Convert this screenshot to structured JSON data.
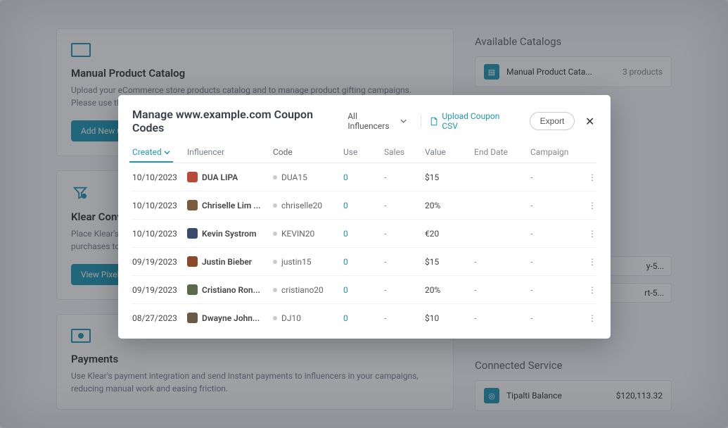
{
  "bg": {
    "catalog": {
      "title": "Manual Product Catalog",
      "desc": "Upload your eCommerce store products catalog and to manage product gifting campaigns. Please use the template below.",
      "btn": "Add New C"
    },
    "conv": {
      "title": "Klear Conv",
      "desc1": "Place Klear's c",
      "desc2": "purchases to a",
      "btn": "View Pixel"
    },
    "payments": {
      "title": "Payments",
      "desc": "Use Klear's payment integration and send instant payments to influencers in your campaigns, reducing manual work and easing friction."
    },
    "side": {
      "catalogs_h": "Available Catalogs",
      "cat_name": "Manual Product Cata...",
      "cat_count": "3 products",
      "conn_h": "Connected Service",
      "conn_name": "Tipalti Balance",
      "conn_val": "$120,113.32",
      "pixel1": "y-5...",
      "pixel2": "rt-5..."
    }
  },
  "modal": {
    "title": "Manage www.example.com Coupon Codes",
    "filter": "All Influencers",
    "upload": "Upload Coupon CSV",
    "export": "Export"
  },
  "headers": {
    "created": "Created",
    "influencer": "Influencer",
    "code": "Code",
    "use": "Use",
    "sales": "Sales",
    "value": "Value",
    "end": "End Date",
    "campaign": "Campaign"
  },
  "rows": [
    {
      "created": "10/10/2023",
      "name": "DUA LIPA",
      "av": "#b84a3a",
      "code": "DUA15",
      "use": "0",
      "sales": "-",
      "value": "$15",
      "end": "",
      "camp": "-"
    },
    {
      "created": "10/10/2023",
      "name": "Chriselle Lim ...",
      "av": "#7a5c3e",
      "code": "chriselle20",
      "use": "0",
      "sales": "-",
      "value": "20%",
      "end": "",
      "camp": "-"
    },
    {
      "created": "10/10/2023",
      "name": "Kevin Systrom",
      "av": "#3a4a6a",
      "code": "KEVIN20",
      "use": "0",
      "sales": "-",
      "value": "€20",
      "end": "",
      "camp": "-"
    },
    {
      "created": "09/19/2023",
      "name": "Justin Bieber",
      "av": "#8a4a2a",
      "code": "justin15",
      "use": "0",
      "sales": "-",
      "value": "$15",
      "end": "-",
      "camp": "-"
    },
    {
      "created": "09/19/2023",
      "name": "Cristiano Ron...",
      "av": "#5a6a4a",
      "code": "cristiano20",
      "use": "0",
      "sales": "-",
      "value": "20%",
      "end": "-",
      "camp": "-"
    },
    {
      "created": "08/27/2023",
      "name": "Dwayne John...",
      "av": "#6a5a4a",
      "code": "DJ10",
      "use": "0",
      "sales": "-",
      "value": "$10",
      "end": "-",
      "camp": "-"
    }
  ]
}
